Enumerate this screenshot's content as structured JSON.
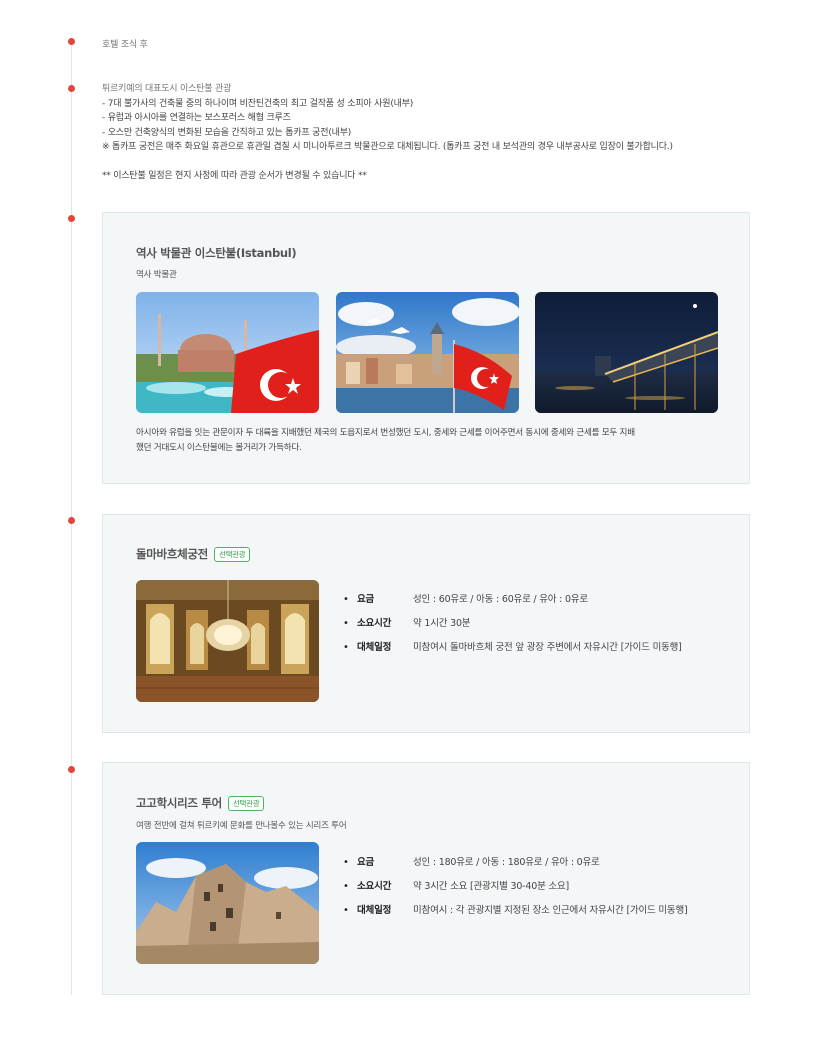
{
  "breakfast": {
    "text": "호텔 조식 후"
  },
  "istanbul_intro": {
    "line1": "튀르키예의 대표도시 이스탄불 관광",
    "line2": "- 7대 불가사의 건축물 중의 하나이며 비잔틴건축의 최고 걸작품 성 소피아 사원(내부)",
    "line3": "- 유럽과 아시아를 연결하는 보스포러스 해협 크루즈",
    "line4": "- 오스만 건축양식의 변화된 모습을 간직하고 있는 톱카프 궁전(내부)",
    "line5": "※ 톱카프 궁전은 매주 화요일 휴관으로 휴관일 겹칠 시 미니아투르크 박물관으로 대체됩니다. (톱카프 궁전 내 보석관의 경우 내부공사로 입장이 불가합니다.)",
    "note": "** 이스탄불 일정은 현지 사정에 따라 관광 순서가 변경될 수 있습니다 **"
  },
  "istanbul_card": {
    "title": "역사 박물관 이스탄불(Istanbul)",
    "subtitle": "역사 박물관",
    "photos": [
      "hagia-sophia-flag-photo",
      "galata-tower-flag-photo",
      "night-bridge-photo"
    ],
    "desc_line1": "아시아와 유럽을 잇는 관문이자 두 대륙을 지배했던 제국의 도읍지로서 번성했던 도시, 중세와 근세를 이어주면서 동시에 중세와 근세를 모두 지배",
    "desc_line2": "했던 거대도시 이스탄불에는 볼거리가 가득하다."
  },
  "dolmabahce_card": {
    "title": "돌마바흐체궁전",
    "badge": "선택관광",
    "photo": "palace-interior-photo",
    "info": [
      {
        "key": "요금",
        "value": "성인 : 60유로 / 아동 : 60유로 / 유아 : 0유로"
      },
      {
        "key": "소요시간",
        "value": "약 1시간 30분"
      },
      {
        "key": "대체일정",
        "value": "미참여시 돌마바흐체 궁전 앞 광장 주변에서 자유시간 [가이드 미동행]"
      }
    ]
  },
  "series_card": {
    "title": "고고학시리즈 투어",
    "badge": "선택관광",
    "subtitle": "여행 전반에 걸쳐 튀르키예 문화를 만나볼수 있는 시리즈 투어",
    "photo": "cappadocia-rock-photo",
    "info": [
      {
        "key": "요금",
        "value": "성인 : 180유로 / 아동 : 180유로 / 유아 : 0유로"
      },
      {
        "key": "소요시간",
        "value": "약 3시간 소요 [관광지별 30-40분 소요]"
      },
      {
        "key": "대체일정",
        "value": "미참여시 : 각 관광지별 지정된 장소 인근에서 자유시간 [가이드 미동행]"
      }
    ]
  },
  "colors": {
    "dot": "#e2463a",
    "badge": "#2fa04a",
    "card_bg": "#f4f7f8"
  }
}
